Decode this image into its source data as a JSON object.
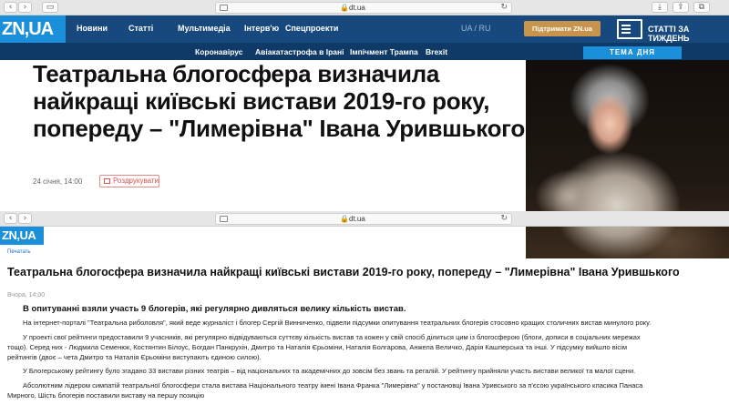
{
  "browser": {
    "url": "dt.ua",
    "lock_icon": "lock-icon",
    "reload_icon": "reload-icon"
  },
  "site": {
    "logo": "ZN,UA",
    "logo_color": "#1b8fd9",
    "nav_bg": "#17497e"
  },
  "nav": {
    "items": [
      "Новини",
      "Статті",
      "Мультимедіа",
      "Інтерв'ю",
      "Спецпроекти"
    ],
    "lang": "UA / RU",
    "support": "Підтримати ZN.ua",
    "magazine": "СТАТТІ ЗА ТИЖДЕНЬ"
  },
  "topics": {
    "items": [
      "Коронавірус",
      "Авіакатастрофа в Ірані",
      "Імпічмент Трампа",
      "Brexit"
    ],
    "tema": "ТЕМА ДНЯ"
  },
  "article": {
    "headline": "Театральна блогосфера визначила найкращі київські вистави 2019-го року, попереду – \"Лимерівна\" Івана Урившького",
    "date": "24 січня, 14:00",
    "print_label": "Роздрукувати"
  },
  "print_view": {
    "logo": "ZN,UA",
    "breadcrumb": "Печатать",
    "title": "Театральна блогосфера визначила найкращі київські вистави 2019-го року, попереду – \"Лимерівна\" Івана Урившького",
    "date": "Вчора, 14:00",
    "lead": "В опитуванні взяли участь 9 блогерів, які регулярно дивляться велику кількість вистав.",
    "paragraphs": [
      "На інтернет-порталі \"Театральна риболовля\", який веде журналіст і блогер Сергій Винниченко, підвели підсумки опитування театральних блогерів стосовно кращих столичних вистав минулого року.",
      "У проекті свої рейтинги предоставили 9 учасників, які регулярно відвідуваються суттєву кількість вистав та кожен у свій спосіб ділиться цим із блогосферою (блоги, дописи в соціальних мережах тощо). Серед них - Людмила Семенюк, Костянтин Білоус, Богдан Панкрухін, Дмитро та Наталія Єрьоміни, Наталія Болгарова, Анжела Величко, Дарія Кашперська та інші. У підсумку вийшло вісім рейтингів (двоє – чета Дмитро та Наталія Єрьоміни виступають єдиною силою).",
      "У Блогерському рейтингу було згадано 33 вистави різних театрів – від національних та академічних до зовсім без звань та регалій. У рейтингу прийняли участь вистави великої та малої сцени.",
      "Абсолютним лідером симпатій театральної блогосфери стала вистава Національного театру імені Івана Франка \"Лимерівна\" у постановці Івана Уривського за п'єсою українського класика Панаса Мирного. Шість блогерів поставили виставу на першу позицію"
    ]
  }
}
